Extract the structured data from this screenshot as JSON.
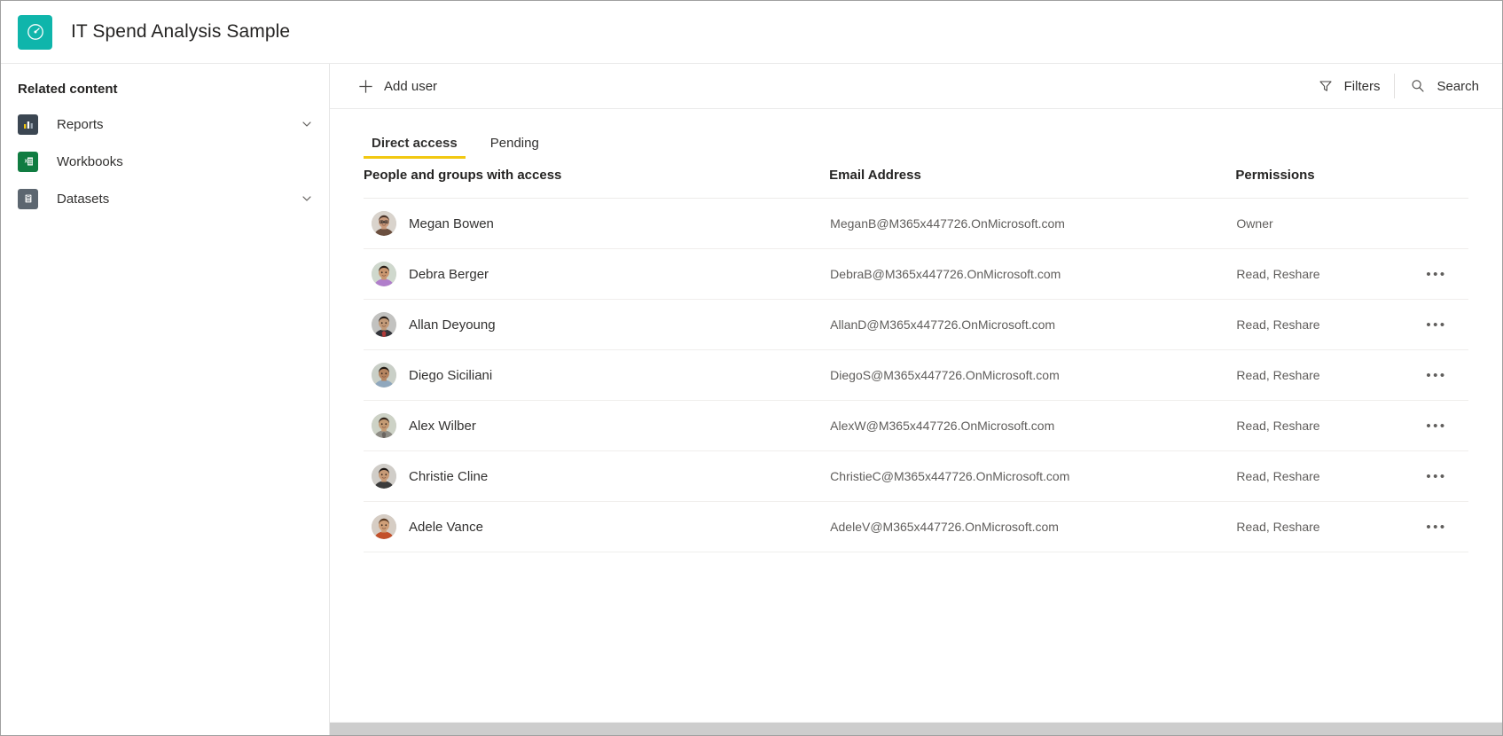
{
  "header": {
    "title": "IT Spend Analysis Sample",
    "logo_icon": "gauge-icon",
    "logo_color": "#0fb5ab"
  },
  "sidebar": {
    "title": "Related content",
    "items": [
      {
        "label": "Reports",
        "icon": "report-bar-chart-icon",
        "icon_color": "#3b4652",
        "expandable": true
      },
      {
        "label": "Workbooks",
        "icon": "excel-workbook-icon",
        "icon_color": "#107c41",
        "expandable": false
      },
      {
        "label": "Datasets",
        "icon": "dataset-database-icon",
        "icon_color": "#5c6670",
        "expandable": true
      }
    ],
    "chevron_icon": "chevron-down-icon"
  },
  "toolbar": {
    "add_user_label": "Add user",
    "add_user_icon": "plus-icon",
    "filters_label": "Filters",
    "filters_icon": "funnel-icon",
    "search_label": "Search",
    "search_icon": "magnifier-icon"
  },
  "tabs": [
    {
      "label": "Direct access",
      "selected": true
    },
    {
      "label": "Pending",
      "selected": false
    }
  ],
  "tab_accent_color": "#f2c811",
  "table": {
    "columns": [
      "People and groups with access",
      "Email Address",
      "Permissions",
      ""
    ],
    "more_glyph": "•••",
    "rows": [
      {
        "name": "Megan Bowen",
        "email": "MeganB@M365x447726.OnMicrosoft.com",
        "permission": "Owner",
        "has_menu": false,
        "avatar": "photo-megan"
      },
      {
        "name": "Debra Berger",
        "email": "DebraB@M365x447726.OnMicrosoft.com",
        "permission": "Read, Reshare",
        "has_menu": true,
        "avatar": "photo-debra"
      },
      {
        "name": "Allan Deyoung",
        "email": "AllanD@M365x447726.OnMicrosoft.com",
        "permission": "Read, Reshare",
        "has_menu": true,
        "avatar": "photo-allan"
      },
      {
        "name": "Diego Siciliani",
        "email": "DiegoS@M365x447726.OnMicrosoft.com",
        "permission": "Read, Reshare",
        "has_menu": true,
        "avatar": "photo-diego"
      },
      {
        "name": "Alex Wilber",
        "email": "AlexW@M365x447726.OnMicrosoft.com",
        "permission": "Read, Reshare",
        "has_menu": true,
        "avatar": "photo-alex"
      },
      {
        "name": "Christie Cline",
        "email": "ChristieC@M365x447726.OnMicrosoft.com",
        "permission": "Read, Reshare",
        "has_menu": true,
        "avatar": "photo-christie"
      },
      {
        "name": "Adele Vance",
        "email": "AdeleV@M365x447726.OnMicrosoft.com",
        "permission": "Read, Reshare",
        "has_menu": true,
        "avatar": "photo-adele"
      }
    ]
  }
}
